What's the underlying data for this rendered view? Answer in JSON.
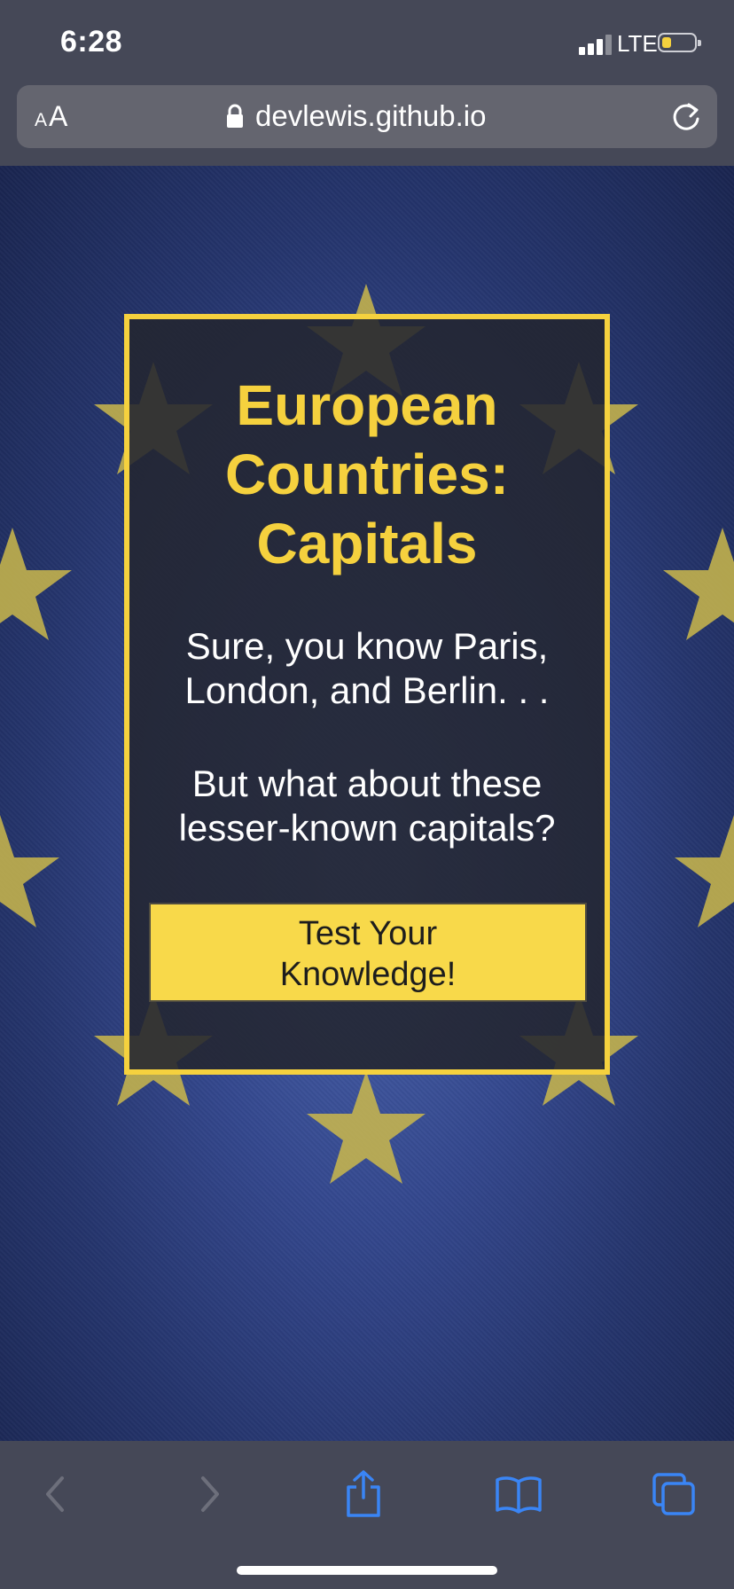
{
  "status_bar": {
    "time": "6:28",
    "network": "LTE",
    "battery_level": 0.3,
    "battery_color": "#f5d13e"
  },
  "browser": {
    "reader_label_small": "A",
    "reader_label_large": "A",
    "url": "devlewis.github.io"
  },
  "page": {
    "title_lines": [
      "European",
      "Countries:",
      "Capitals"
    ],
    "intro_lines": [
      "Sure, you know Paris,",
      "London, and Berlin. . ."
    ],
    "question_lines": [
      "But what about these",
      "lesser-known capitals?"
    ],
    "button_lines": [
      "Test Your",
      "Knowledge!"
    ],
    "accent_color": "#f5d13e"
  },
  "toolbar": {
    "items": [
      "back-icon",
      "forward-icon",
      "share-icon",
      "bookmarks-icon",
      "tabs-icon"
    ]
  }
}
